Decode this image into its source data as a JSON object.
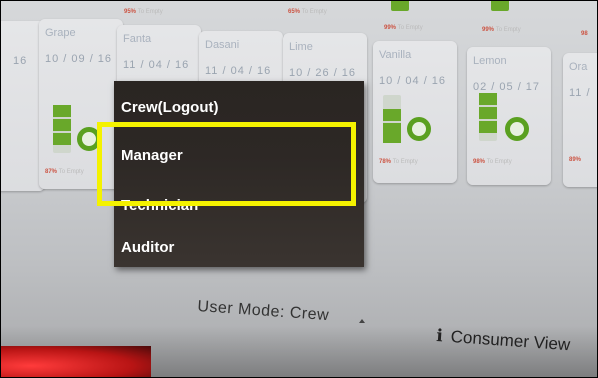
{
  "tiles": [
    {
      "name": "",
      "date": "16",
      "pct": "",
      "pct_suffix": "To Empty"
    },
    {
      "name": "Grape",
      "date": "10 / 09 / 16",
      "pct": "87%",
      "pct_suffix": "To Empty"
    },
    {
      "name": "Fanta",
      "date": "11 / 04 / 16",
      "pct": "",
      "pct_suffix": ""
    },
    {
      "name": "Dasani",
      "date": "11 / 04 / 16",
      "pct": "",
      "pct_suffix": ""
    },
    {
      "name": "Lime",
      "date": "10 / 26 / 16",
      "pct": "",
      "pct_suffix": ""
    },
    {
      "name": "Vanilla",
      "date": "10 / 04 / 16",
      "pct": "78%",
      "pct_suffix": "To Empty"
    },
    {
      "name": "Lemon",
      "date": "02 / 05 / 17",
      "pct": "98%",
      "pct_suffix": "To Empty"
    },
    {
      "name": "Ora",
      "date": "11 /",
      "pct": "89%",
      "pct_suffix": ""
    }
  ],
  "top_row": [
    {
      "pct": "95%",
      "suffix": "To Empty"
    },
    {
      "pct": "65%",
      "suffix": "To Empty"
    },
    {
      "pct": "99%",
      "suffix": "To Empty"
    },
    {
      "pct": "99%",
      "suffix": "To Empty"
    },
    {
      "pct": "98",
      "suffix": ""
    }
  ],
  "menu": {
    "items": [
      "Crew(Logout)",
      "Manager",
      "Technician",
      "Auditor"
    ]
  },
  "status": {
    "user_mode": "User Mode: Crew",
    "consumer_icon": "i",
    "consumer_label": "Consumer View"
  },
  "colors": {
    "highlight": "#f4f200",
    "battery": "#69a82a",
    "menu_bg": "#2a2522"
  }
}
